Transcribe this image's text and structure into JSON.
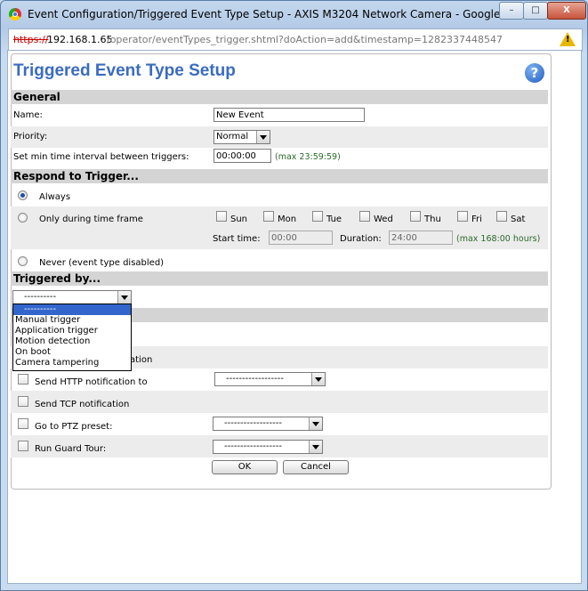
{
  "window": {
    "title": "Event Configuration/Triggered Event Type Setup - AXIS M3204 Network Camera - Google Chro...",
    "minimize": "–",
    "maximize": "□",
    "close": "X"
  },
  "address_bar": {
    "scheme": "https://",
    "host": "192.168.1.65",
    "path": "/operator/eventTypes_trigger.shtml?doAction=add&timestamp=1282337448547",
    "warning": "!"
  },
  "page": {
    "title": "Triggered Event Type Setup",
    "help": "?"
  },
  "general": {
    "heading": "General",
    "name_label": "Name:",
    "name_value": "New Event",
    "priority_label": "Priority:",
    "priority_value": "Normal",
    "interval_label": "Set min time interval between triggers:",
    "interval_value": "00:00:00",
    "interval_hint": "(max 23:59:59)"
  },
  "respond": {
    "heading": "Respond to Trigger...",
    "always_label": "Always",
    "timeframe_label": "Only during time frame",
    "days": [
      "Sun",
      "Mon",
      "Tue",
      "Wed",
      "Thu",
      "Fri",
      "Sat"
    ],
    "start_label": "Start time:",
    "start_value": "00:00",
    "duration_label": "Duration:",
    "duration_value": "24:00",
    "duration_hint": "(max 168:00 hours)",
    "never_label": "Never (event type disabled)"
  },
  "triggered": {
    "heading": "Triggered by...",
    "selected": "----------",
    "options": [
      "----------",
      "Manual trigger",
      "Application trigger",
      "Motion detection",
      "On boot",
      "Camera tampering"
    ]
  },
  "actions": {
    "hidden_tail": "ation",
    "http_label": "Send HTTP notification to",
    "http_select": "------------------",
    "tcp_label": "Send TCP notification",
    "ptz_label": "Go to PTZ preset:",
    "ptz_select": "------------------",
    "guard_label": "Run Guard Tour:",
    "guard_select": "------------------"
  },
  "buttons": {
    "ok": "OK",
    "cancel": "Cancel"
  }
}
